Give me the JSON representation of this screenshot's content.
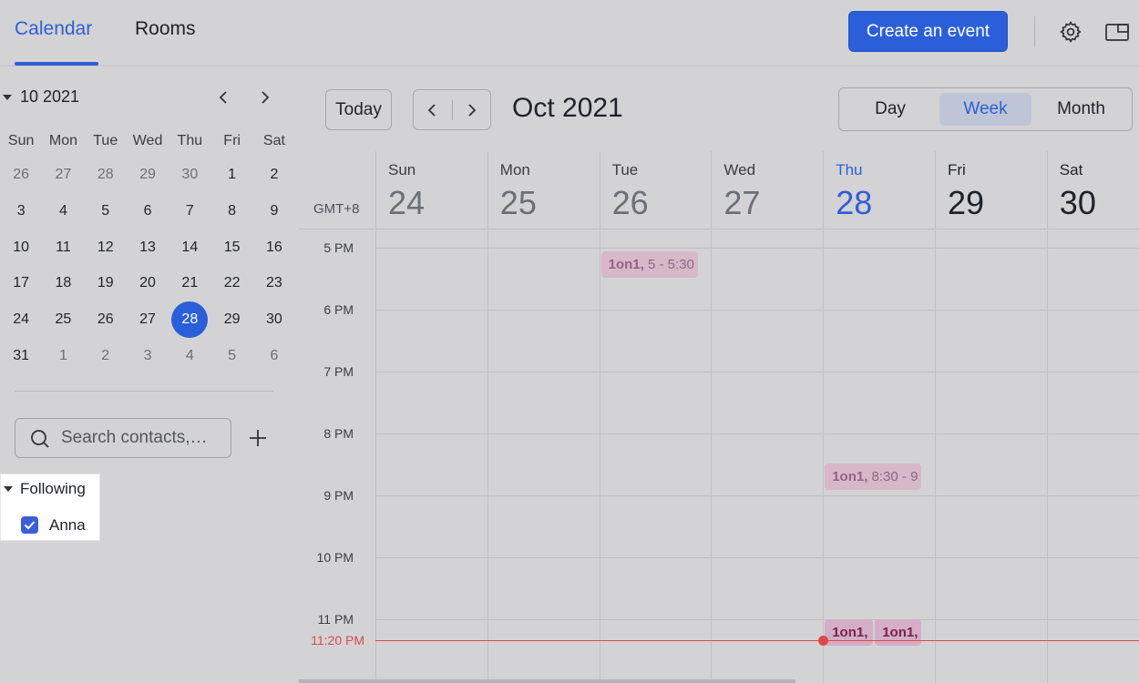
{
  "top_tabs": {
    "calendar": "Calendar",
    "rooms": "Rooms"
  },
  "create_event_label": "Create an event",
  "colors": {
    "accent": "#2b5fd9",
    "current_time": "#e04848",
    "event_bg": "#d7afc3"
  },
  "mini_calendar": {
    "title": "10 2021",
    "weekdays": [
      "Sun",
      "Mon",
      "Tue",
      "Wed",
      "Thu",
      "Fri",
      "Sat"
    ],
    "weeks": [
      [
        "26",
        "27",
        "28",
        "29",
        "30",
        "1",
        "2"
      ],
      [
        "3",
        "4",
        "5",
        "6",
        "7",
        "8",
        "9"
      ],
      [
        "10",
        "11",
        "12",
        "13",
        "14",
        "15",
        "16"
      ],
      [
        "17",
        "18",
        "19",
        "20",
        "21",
        "22",
        "23"
      ],
      [
        "24",
        "25",
        "26",
        "27",
        "28",
        "29",
        "30"
      ],
      [
        "31",
        "1",
        "2",
        "3",
        "4",
        "5",
        "6"
      ]
    ],
    "selected_day": "28"
  },
  "search": {
    "placeholder": "Search contacts,…"
  },
  "following": {
    "title": "Following",
    "contacts": [
      {
        "name": "Anna",
        "checked": true
      }
    ]
  },
  "toolbar": {
    "today_label": "Today",
    "month_title": "Oct 2021"
  },
  "views": {
    "day": "Day",
    "week": "Week",
    "month": "Month",
    "active": "Week"
  },
  "timezone_label": "GMT+8",
  "week_days": [
    {
      "name": "Sun",
      "num": "24"
    },
    {
      "name": "Mon",
      "num": "25"
    },
    {
      "name": "Tue",
      "num": "26"
    },
    {
      "name": "Wed",
      "num": "27"
    },
    {
      "name": "Thu",
      "num": "28",
      "today": true
    },
    {
      "name": "Fri",
      "num": "29"
    },
    {
      "name": "Sat",
      "num": "30"
    }
  ],
  "hour_labels": [
    "5 PM",
    "6 PM",
    "7 PM",
    "8 PM",
    "9 PM",
    "10 PM",
    "11 PM"
  ],
  "current_time_label": "11:20 PM",
  "events": [
    {
      "title": "1on1,",
      "time": " 5 - 5:30"
    },
    {
      "title": "1on1,",
      "time": " 8:30 - 9"
    },
    {
      "title": "1on1,",
      "time": ""
    },
    {
      "title": "1on1,",
      "time": ""
    }
  ]
}
